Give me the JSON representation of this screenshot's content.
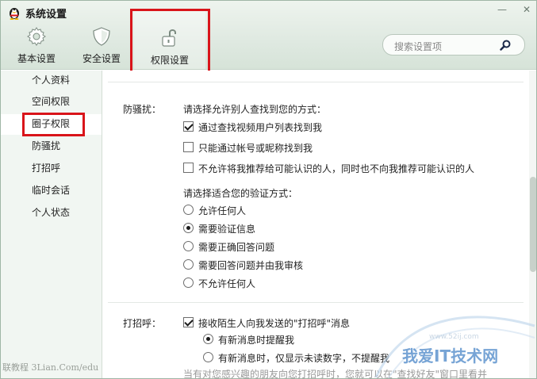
{
  "window": {
    "title": "系统设置",
    "minimize_glyph": "—",
    "close_glyph": "✕"
  },
  "toolbar": {
    "items": [
      {
        "label": "基本设置",
        "icon": "gear-icon"
      },
      {
        "label": "安全设置",
        "icon": "shield-icon"
      },
      {
        "label": "权限设置",
        "icon": "unlocked-lock-icon",
        "selected": true
      }
    ]
  },
  "search": {
    "placeholder": "搜索设置项"
  },
  "sidebar": {
    "items": [
      {
        "label": "个人资料"
      },
      {
        "label": "空间权限"
      },
      {
        "label": "圈子权限",
        "active": true
      },
      {
        "label": "防骚扰"
      },
      {
        "label": "打招呼"
      },
      {
        "label": "临时会话"
      },
      {
        "label": "个人状态"
      }
    ]
  },
  "anti_harass": {
    "section_label": "防骚扰：",
    "find_prompt": "请选择允许别人查找到您的方式：",
    "find_options": [
      {
        "label": "通过查找视频用户列表找到我",
        "checked": true
      },
      {
        "label": "只能通过帐号或昵称找到我",
        "checked": false
      },
      {
        "label": "不允许将我推荐给可能认识的人，同时也不向我推荐可能认识的人",
        "checked": false
      }
    ],
    "verify_prompt": "请选择适合您的验证方式：",
    "verify_options": [
      {
        "label": "允许任何人",
        "selected": false
      },
      {
        "label": "需要验证信息",
        "selected": true
      },
      {
        "label": "需要正确回答问题",
        "selected": false
      },
      {
        "label": "需要回答问题并由我审核",
        "selected": false
      },
      {
        "label": "不允许任何人",
        "selected": false
      }
    ]
  },
  "greeting": {
    "section_label": "打招呼：",
    "accept_label": "接收陌生人向我发送的\"打招呼\"消息",
    "accept_checked": true,
    "notify_options": [
      {
        "label": "有新消息时提醒我",
        "selected": true
      },
      {
        "label": "有新消息时，仅显示未读数字，不提醒我",
        "selected": false
      }
    ],
    "hint": "当有对您感兴趣的朋友向您打招呼时，您就可以在\"查找好友\"窗口里看并"
  },
  "watermarks": {
    "left": "联教程 3Lian.Com/edu",
    "right": "我爱IT技术网",
    "url": "www.52ij.com"
  },
  "colors": {
    "highlight_red": "#d9141a",
    "sidebar_bg": "#f1f6f2",
    "toolbar_bg": "#dfe9e1"
  }
}
